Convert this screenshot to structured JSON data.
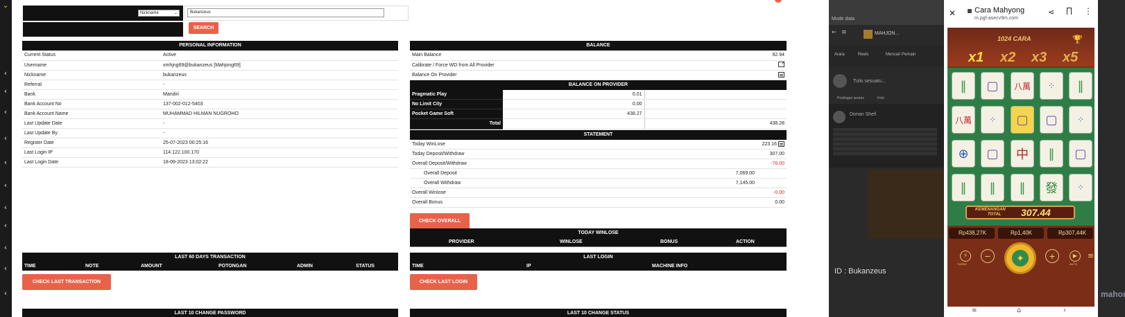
{
  "search": {
    "select_value": "Nickname",
    "input_value": "Bukanzeus",
    "button": "SEARCH"
  },
  "personal": {
    "title": "PERSONAL INFORMATION",
    "rows": [
      {
        "label": "Current Status",
        "value": "Active"
      },
      {
        "label": "Username",
        "value": "xmhjng69@bukanzeus  [Mahjong69]"
      },
      {
        "label": "Nickname",
        "value": "bukanzeus"
      },
      {
        "label": "Referral",
        "value": "-"
      },
      {
        "label": "Bank",
        "value": "Mandiri"
      },
      {
        "label": "Bank Account No",
        "value": "137-002-012-5403"
      },
      {
        "label": "Bank Account Name",
        "value": "MUHAMMAD HILMAN NUGROHO"
      },
      {
        "label": "Last Update Date",
        "value": "-"
      },
      {
        "label": "Last Update By",
        "value": "-"
      },
      {
        "label": "Register Date",
        "value": "25-07-2023 00:25:16"
      },
      {
        "label": "Last Login IP",
        "value": "114.122.100.170"
      },
      {
        "label": "Last Login Date",
        "value": "18-09-2023 13:02:22"
      }
    ]
  },
  "balance": {
    "title": "BALANCE",
    "main_label": "Main Balance",
    "main_value": "92.94",
    "calibrate_label": "Calibrate / Force WD from All Provider",
    "on_provider_label": "Balance On Provider"
  },
  "provider": {
    "title": "BALANCE ON PROVIDER",
    "rows": [
      {
        "name": "Pragmatic Play",
        "value": "0.01"
      },
      {
        "name": "No Limit City",
        "value": "0.00"
      },
      {
        "name": "Pocket Game Soft",
        "value": "438.27"
      }
    ],
    "total_label": "Total",
    "total_value": "438.28"
  },
  "statement": {
    "title": "STATEMENT",
    "today_winlose_label": "Today WinLose",
    "today_winlose_value": "223.16",
    "today_dw_label": "Today Deposit/Withdraw",
    "today_dw_value": "307.00",
    "overall_dw_label": "Overall Deposit/Withdraw",
    "overall_dw_value": "-76.00",
    "overall_deposit_label": "Overall Deposit",
    "overall_deposit_value": "7,069.00",
    "overall_withdraw_label": "Overall Withdraw",
    "overall_withdraw_value": "7,145.00",
    "overall_winlose_label": "Overall Winlose",
    "overall_winlose_value": "-0.00",
    "overall_bonus_label": "Overall Bonus",
    "overall_bonus_value": "0.00",
    "check_button": "CHECK OVERALL"
  },
  "today_winlose": {
    "title": "TODAY WINLOSE",
    "cols": [
      "PROVIDER",
      "WINLOSE",
      "BONUS",
      "ACTION"
    ]
  },
  "transaction": {
    "title": "LAST 60 DAYS TRANSACTION",
    "cols": [
      "TIME",
      "NOTE",
      "AMOUNT",
      "POTONGAN",
      "ADMIN",
      "STATUS"
    ],
    "button": "CHECK LAST TRANSACTION"
  },
  "last_login": {
    "title": "LAST LOGIN",
    "cols": [
      "TIME",
      "IP",
      "MACHINE INFO"
    ],
    "button": "CHECK LAST LOGIN"
  },
  "change_password": {
    "title": "LAST 10 CHANGE PASSWORD"
  },
  "change_status": {
    "title": "LAST 10 CHANGE STATUS"
  },
  "phone": {
    "title": "Cara Mahyong",
    "url": "m.pgf-asecv9m.com",
    "ways": "1024 CARA",
    "multipliers": [
      "x1",
      "x2",
      "x3",
      "x5"
    ],
    "win_label_1": "KEMENANGAN",
    "win_label_2": "TOTAL",
    "win_value": "307.44",
    "balance": "Rp438,27K",
    "bet": "Rp1,40K",
    "win": "Rp307,44K",
    "turbo": "TURBO",
    "auto": "AUTO"
  },
  "background_app": {
    "mode": "Mode data",
    "tab": "MAHJON...",
    "post": "Tulis sesuatu...",
    "user": "Dorian Shell",
    "id_text": "ID : Bukanzeus",
    "brand": "mahongways",
    "filters": [
      "Arara",
      "Reels",
      "Mencari Pemain"
    ],
    "actions": [
      "Postingan anaras",
      "Foto"
    ]
  },
  "colors": {
    "accent": "#e8624a",
    "header": "#111111",
    "negative": "#e02020"
  }
}
